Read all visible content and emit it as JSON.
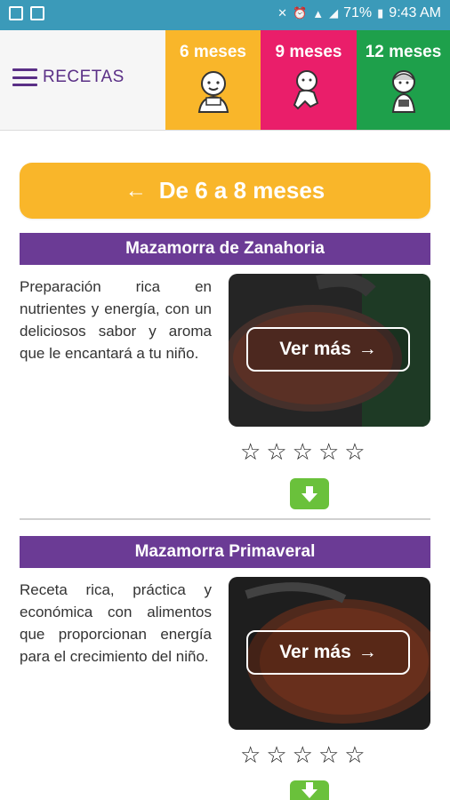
{
  "status_bar": {
    "battery": "71%",
    "time": "9:43 AM"
  },
  "header": {
    "menu_label": "RECETAS",
    "tabs": [
      {
        "label": "6 meses",
        "color": "#f9b62a"
      },
      {
        "label": "9 meses",
        "color": "#ea1e6a"
      },
      {
        "label": "12 meses",
        "color": "#1ea04b"
      }
    ]
  },
  "range_button": {
    "label": "De 6 a 8 meses",
    "color": "#f9b62a"
  },
  "recipes": [
    {
      "title": "Mazamorra de Zanahoria",
      "description": "Preparación rica en nutrientes y energía, con un deliciosos sabor y aroma que le encantará a tu niño.",
      "more_label": "Ver más",
      "rating_stars": 5,
      "rating_filled": 0
    },
    {
      "title": "Mazamorra Primaveral",
      "description": "Receta rica, práctica y económica con alimentos que proporcionan energía para el crecimiento del niño.",
      "more_label": "Ver más",
      "rating_stars": 5,
      "rating_filled": 0
    }
  ],
  "colors": {
    "title_bar": "#6b3b95",
    "download": "#6ac13b",
    "status_bar": "#3b9ab9"
  }
}
